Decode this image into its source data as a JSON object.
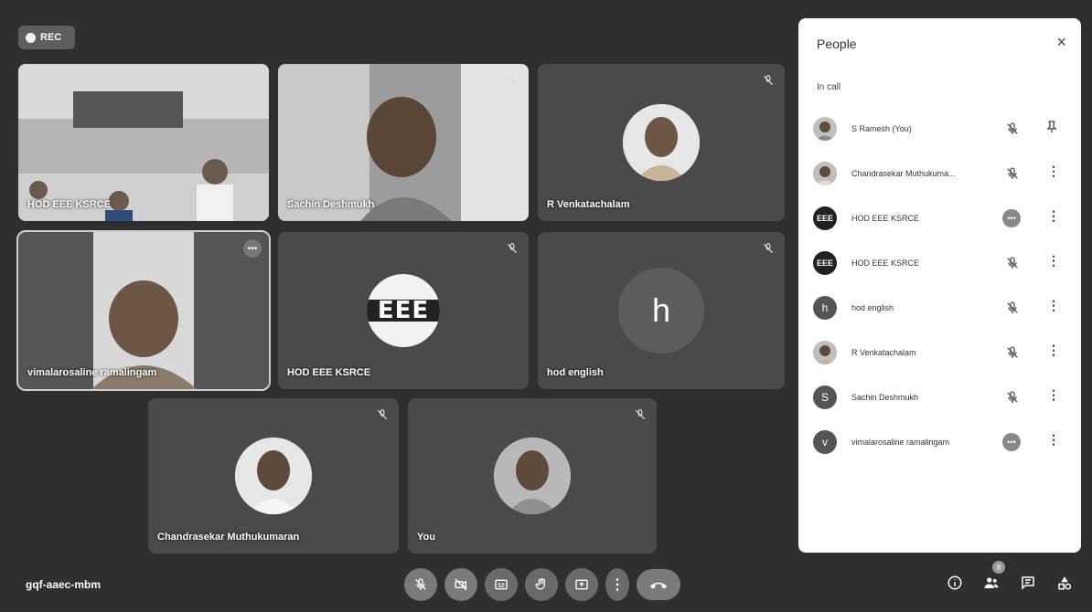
{
  "rec": {
    "label": "REC"
  },
  "tiles": [
    {
      "name": "HOD EEE KSRCE"
    },
    {
      "name": "Sachin Deshmukh"
    },
    {
      "name": "R Venkatachalam"
    },
    {
      "name": "vimalarosaline ramalingam"
    },
    {
      "name": "HOD EEE KSRCE"
    },
    {
      "name": "hod english",
      "letter": "h"
    },
    {
      "name": "Chandrasekar Muthukumaran"
    },
    {
      "name": "You"
    }
  ],
  "logo_text": "EEE",
  "panel": {
    "title": "People",
    "close": "×",
    "section": "In call",
    "people": [
      {
        "name": "S Ramesh (You)",
        "avatar": ""
      },
      {
        "name": "Chandrasekar Muthukuma...",
        "avatar": ""
      },
      {
        "name": "HOD EEE KSRCE",
        "avatar": "EEE"
      },
      {
        "name": "HOD EEE KSRCE",
        "avatar": "EEE"
      },
      {
        "name": "hod english",
        "avatar": "h"
      },
      {
        "name": "R Venkatachalam",
        "avatar": ""
      },
      {
        "name": "Sachin Deshmukh",
        "avatar": "S"
      },
      {
        "name": "vimalarosaline ramalingam",
        "avatar": "v"
      }
    ]
  },
  "bottom": {
    "meeting_code": "gqf-aaec-mbm",
    "participants_count": "8",
    "more_label": "⋮"
  },
  "colors": {
    "background": "#2f2f2f",
    "tile": "#4a4a4a",
    "panel": "#ffffff",
    "button": "#6a6a6a"
  }
}
